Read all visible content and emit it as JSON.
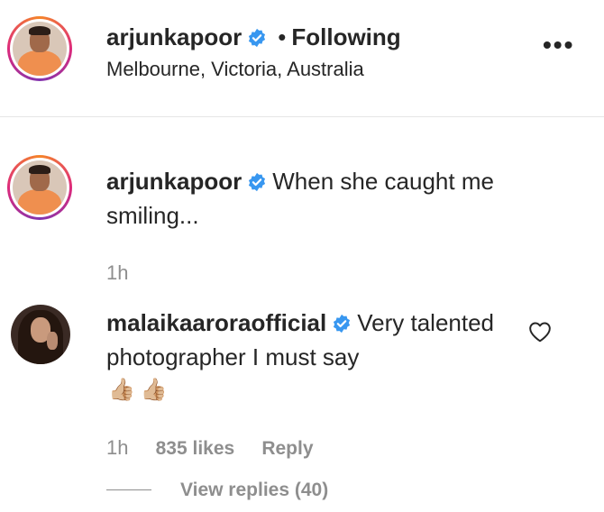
{
  "post_header": {
    "username": "arjunkapoor",
    "separator": "•",
    "follow_status": "Following",
    "location": "Melbourne, Victoria, Australia",
    "more_label": "•••"
  },
  "caption": {
    "username": "arjunkapoor",
    "text": "When she caught me smiling...",
    "time": "1h"
  },
  "comment": {
    "username": "malaikaaroraofficial",
    "text": "Very talented photographer I must say",
    "emoji": "👍🏼👍🏼",
    "time": "1h",
    "likes": "835 likes",
    "reply_label": "Reply",
    "view_replies": "View replies (40)"
  },
  "colors": {
    "verified_blue": "#3897f0",
    "secondary_text": "#8e8e8e",
    "primary_text": "#262626"
  },
  "icons": [
    "verified-badge-icon",
    "more-options-icon",
    "heart-icon"
  ]
}
